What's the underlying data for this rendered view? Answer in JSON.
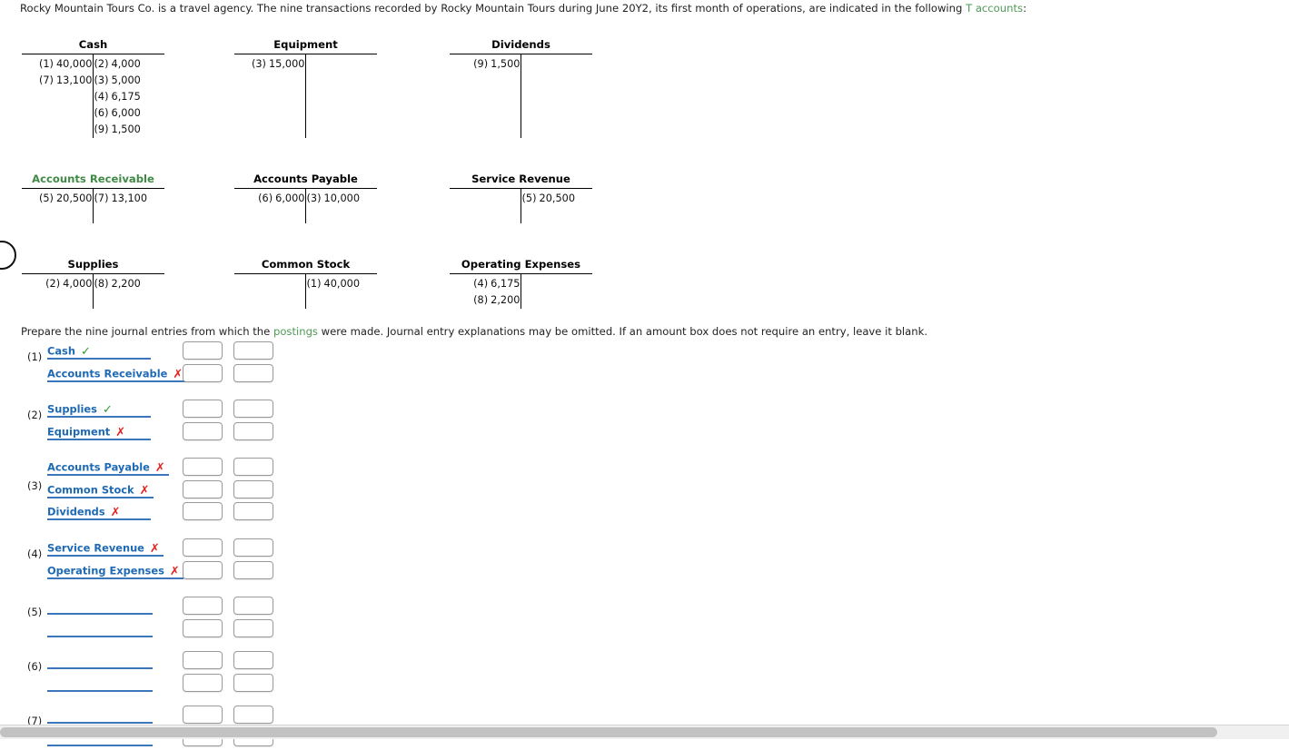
{
  "intro": {
    "before_link": "Rocky Mountain Tours Co. is a travel agency. The nine transactions recorded by Rocky Mountain Tours during June 20Y2, its first month of operations, are indicated in the following ",
    "link": "T accounts",
    "after_link": ":"
  },
  "t_accounts": [
    {
      "title": "Cash",
      "title_color": "#000000",
      "debits": [
        {
          "ref": "(1)",
          "amount": "40,000"
        },
        {
          "ref": "(7)",
          "amount": "13,100"
        }
      ],
      "credits": [
        {
          "ref": "(2)",
          "amount": "4,000"
        },
        {
          "ref": "(3)",
          "amount": "5,000"
        },
        {
          "ref": "(4)",
          "amount": "6,175"
        },
        {
          "ref": "(6)",
          "amount": "6,000"
        },
        {
          "ref": "(9)",
          "amount": "1,500"
        }
      ]
    },
    {
      "title": "Equipment",
      "title_color": "#000000",
      "debits": [
        {
          "ref": "(3)",
          "amount": "15,000"
        }
      ],
      "credits": []
    },
    {
      "title": "Dividends",
      "title_color": "#000000",
      "debits": [
        {
          "ref": "(9)",
          "amount": "1,500"
        }
      ],
      "credits": []
    },
    {
      "title": "Accounts Receivable",
      "title_color": "#3f8a44",
      "debits": [
        {
          "ref": "(5)",
          "amount": "20,500"
        }
      ],
      "credits": [
        {
          "ref": "(7)",
          "amount": "13,100"
        }
      ]
    },
    {
      "title": "Accounts Payable",
      "title_color": "#000000",
      "debits": [
        {
          "ref": "(6)",
          "amount": "6,000"
        }
      ],
      "credits": [
        {
          "ref": "(3)",
          "amount": "10,000"
        }
      ]
    },
    {
      "title": "Service Revenue",
      "title_color": "#000000",
      "debits": [],
      "credits": [
        {
          "ref": "(5)",
          "amount": "20,500"
        }
      ]
    },
    {
      "title": "Supplies",
      "title_color": "#000000",
      "debits": [
        {
          "ref": "(2)",
          "amount": "4,000"
        }
      ],
      "credits": [
        {
          "ref": "(8)",
          "amount": "2,200"
        }
      ]
    },
    {
      "title": "Common Stock",
      "title_color": "#000000",
      "debits": [],
      "credits": [
        {
          "ref": "(1)",
          "amount": "40,000"
        }
      ]
    },
    {
      "title": "Operating Expenses",
      "title_color": "#000000",
      "debits": [
        {
          "ref": "(4)",
          "amount": "6,175"
        },
        {
          "ref": "(8)",
          "amount": "2,200"
        }
      ],
      "credits": []
    }
  ],
  "instruction": {
    "before_link": "Prepare the nine journal entries from which the ",
    "link": "postings",
    "after_link": " were made. Journal entry explanations may be omitted. If an amount box does not require an entry, leave it blank."
  },
  "journal": {
    "entries": [
      {
        "number": "(1)",
        "rows": [
          {
            "account": "Cash",
            "mark": "correct",
            "debit": "",
            "credit": ""
          },
          {
            "account": "Accounts Receivable",
            "mark": "incorrect",
            "debit": "",
            "credit": ""
          }
        ]
      },
      {
        "number": "(2)",
        "rows": [
          {
            "account": "Supplies",
            "mark": "correct",
            "debit": "",
            "credit": ""
          },
          {
            "account": "Equipment",
            "mark": "incorrect",
            "debit": "",
            "credit": ""
          }
        ]
      },
      {
        "number": "(3)",
        "rows": [
          {
            "account": "Accounts Payable",
            "mark": "incorrect",
            "debit": "",
            "credit": ""
          },
          {
            "account": "Common Stock",
            "mark": "incorrect",
            "debit": "",
            "credit": ""
          },
          {
            "account": "Dividends",
            "mark": "incorrect",
            "debit": "",
            "credit": ""
          }
        ]
      },
      {
        "number": "(4)",
        "rows": [
          {
            "account": "Service Revenue",
            "mark": "incorrect",
            "debit": "",
            "credit": ""
          },
          {
            "account": "Operating Expenses",
            "mark": "incorrect",
            "debit": "",
            "credit": ""
          }
        ]
      },
      {
        "number": "(5)",
        "rows": [
          {
            "account": "",
            "mark": "none",
            "debit": "",
            "credit": ""
          },
          {
            "account": "",
            "mark": "none",
            "debit": "",
            "credit": ""
          }
        ]
      },
      {
        "number": "(6)",
        "rows": [
          {
            "account": "",
            "mark": "none",
            "debit": "",
            "credit": ""
          },
          {
            "account": "",
            "mark": "none",
            "debit": "",
            "credit": ""
          }
        ]
      },
      {
        "number": "(7)",
        "rows": [
          {
            "account": "",
            "mark": "none",
            "debit": "",
            "credit": ""
          },
          {
            "account": "",
            "mark": "none",
            "debit": "",
            "credit": ""
          }
        ]
      }
    ]
  },
  "marks": {
    "correct_glyph": "✓",
    "incorrect_glyph": "✗",
    "correct_color": "#2e9b2e",
    "incorrect_color": "#e22121"
  },
  "colors": {
    "account_link": "#1f6ab5",
    "term_link": "#4f9a57",
    "underline": "#3b76ba"
  }
}
